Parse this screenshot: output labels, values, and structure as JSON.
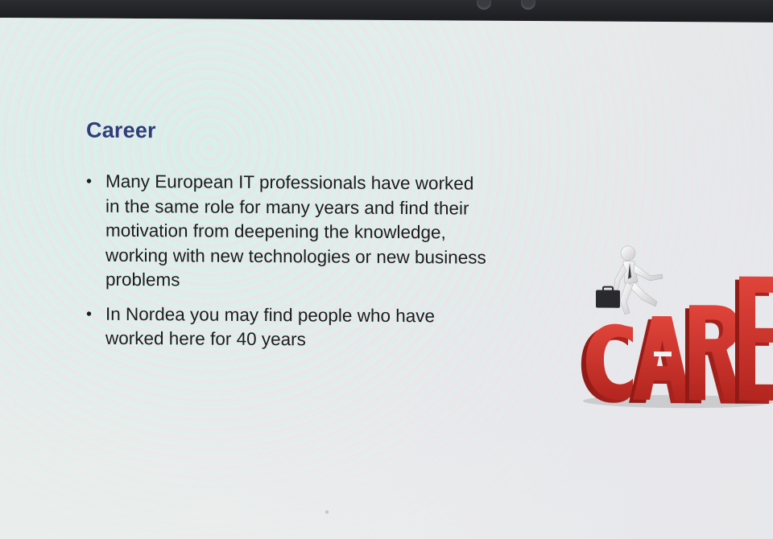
{
  "slide": {
    "title": "Career",
    "bullets": [
      "Many European IT professionals have worked in the same role for many years and find their motivation from deepening the knowledge, working with new technologies or new business problems",
      "In Nordea you may find people who have worked here for 40 years"
    ],
    "bullet_symbol": "•",
    "image": {
      "word": "CAREER",
      "visible_letters": "CARE",
      "letter_color": "#c8302a",
      "description_icon": "businessman-climbing-icon"
    }
  },
  "colors": {
    "title": "#2f3d7a",
    "body_text": "#1c1c1e",
    "screen_bg": "#eceeed",
    "bezel": "#1d1e21"
  }
}
